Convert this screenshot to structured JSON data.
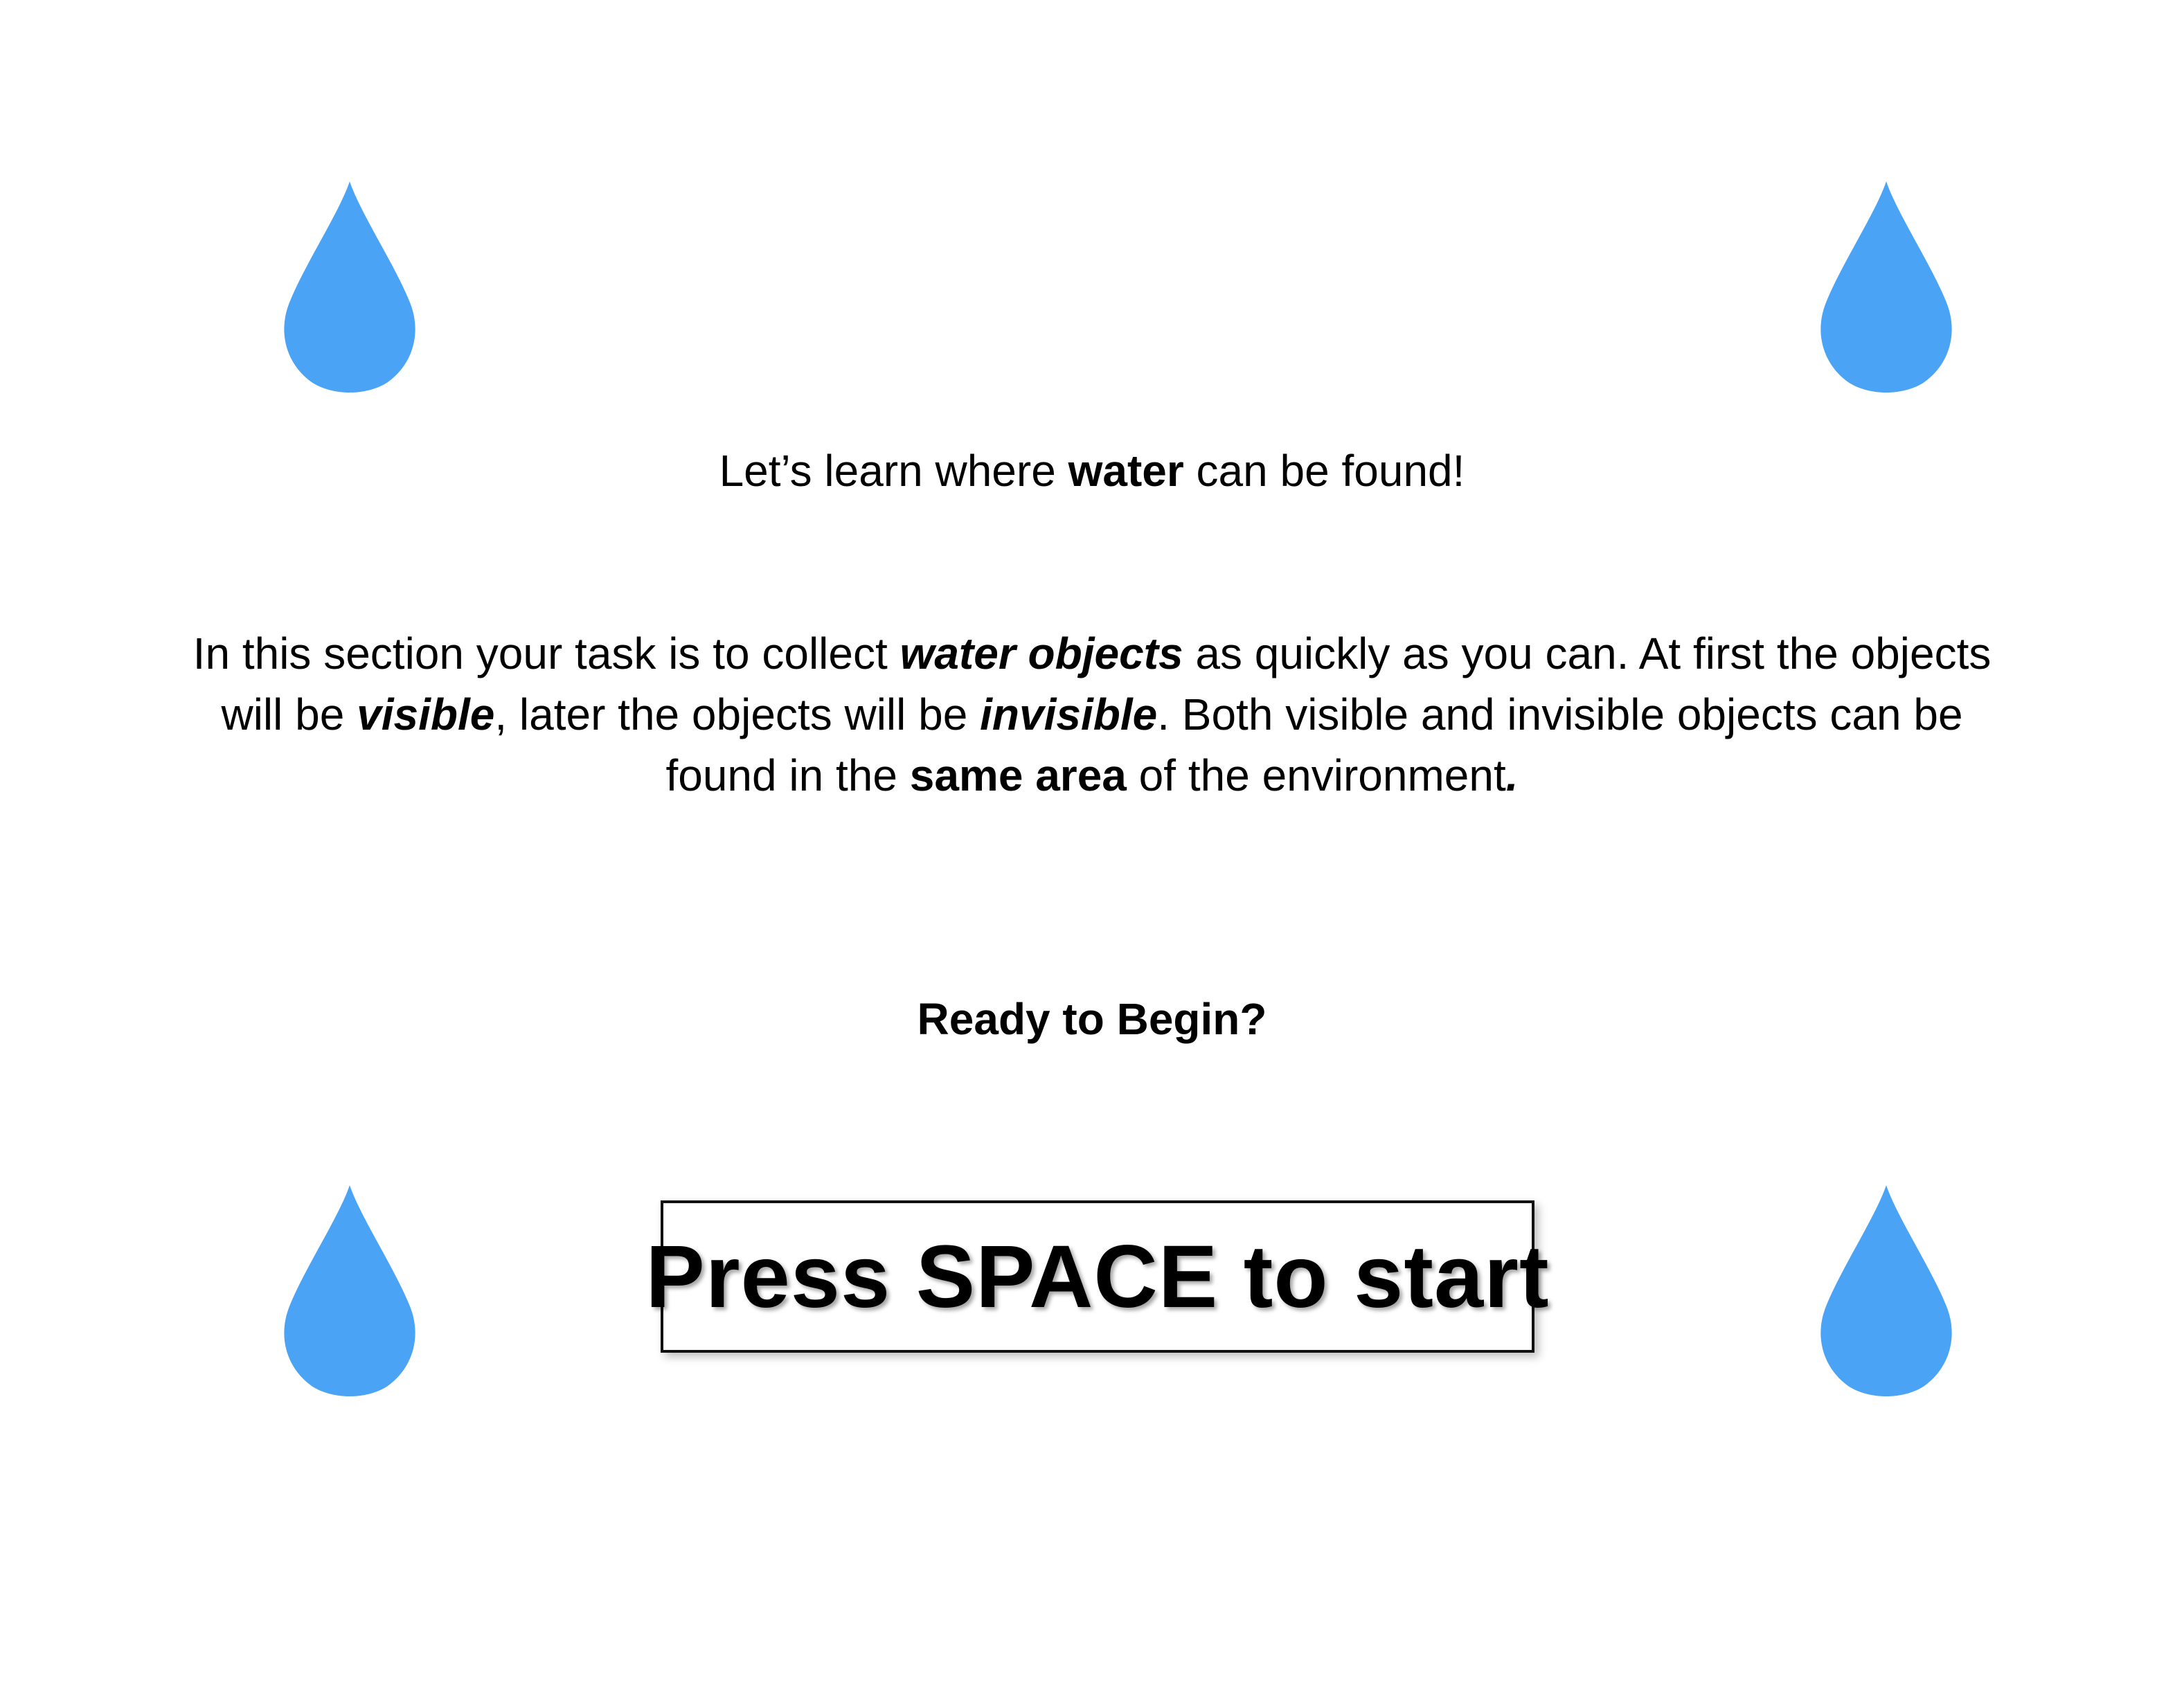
{
  "colors": {
    "drop": "#4aa3f5",
    "background": "#ffffff",
    "text": "#000000"
  },
  "icons": {
    "drop": "water-drop-icon"
  },
  "intro": {
    "before": "Let’s learn where ",
    "bold": "water",
    "after": " can be found!"
  },
  "instructions": {
    "p1": "In this section your task is to collect ",
    "water_objects": "water objects",
    "p2": " as quickly as you can. At first the objects will be ",
    "visible": "visible",
    "p3": ", later the objects will be ",
    "invisible": "invisible",
    "p4": ". Both visible and invisible objects can be found in the ",
    "same_area": "same area",
    "p5": " of the environment",
    "end": "."
  },
  "ready": "Ready to Begin?",
  "start_prompt": "Press SPACE to start"
}
